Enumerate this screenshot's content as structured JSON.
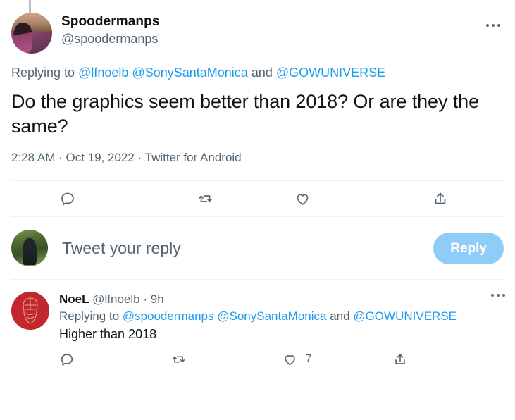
{
  "colors": {
    "link": "#1d9bf0",
    "muted_text": "#536471",
    "primary_text": "#0f1419",
    "reply_button_bg": "#8ecdf8",
    "divider": "#eff3f4",
    "reply_avatar_bg": "#c1272d"
  },
  "main_tweet": {
    "author": {
      "display_name": "Spoodermanps",
      "handle": "@spoodermanps",
      "avatar_name": "spoodermanps-avatar"
    },
    "more_menu_label": "More",
    "replying_to": {
      "prefix": "Replying to",
      "mentions": [
        "@lfnoelb",
        "@SonySantaMonica"
      ],
      "conjunction": "and",
      "last_mention": "@GOWUNIVERSE"
    },
    "text": "Do the graphics seem better than 2018? Or are they the same?",
    "timestamp": "2:28 AM · Oct 19, 2022 · Twitter for Android",
    "actions": [
      {
        "name": "reply",
        "icon": "comment-icon",
        "count": ""
      },
      {
        "name": "retweet",
        "icon": "retweet-icon",
        "count": ""
      },
      {
        "name": "like",
        "icon": "heart-icon",
        "count": ""
      },
      {
        "name": "share",
        "icon": "share-icon",
        "count": ""
      }
    ]
  },
  "composer": {
    "placeholder": "Tweet your reply",
    "button_label": "Reply",
    "avatar_name": "current-user-avatar"
  },
  "reply_tweet": {
    "author": {
      "display_name": "NoeL",
      "handle": "@lfnoelb",
      "avatar_name": "noel-avatar"
    },
    "separator": "·",
    "time_ago": "9h",
    "more_menu_label": "More",
    "replying_to": {
      "prefix": "Replying to",
      "mentions": [
        "@spoodermanps",
        "@SonySantaMonica"
      ],
      "conjunction": "and",
      "last_mention": "@GOWUNIVERSE"
    },
    "text": "Higher than 2018",
    "actions": [
      {
        "name": "reply",
        "icon": "comment-icon",
        "count": ""
      },
      {
        "name": "retweet",
        "icon": "retweet-icon",
        "count": ""
      },
      {
        "name": "like",
        "icon": "heart-icon",
        "count": "7"
      },
      {
        "name": "share",
        "icon": "share-icon",
        "count": ""
      }
    ]
  }
}
